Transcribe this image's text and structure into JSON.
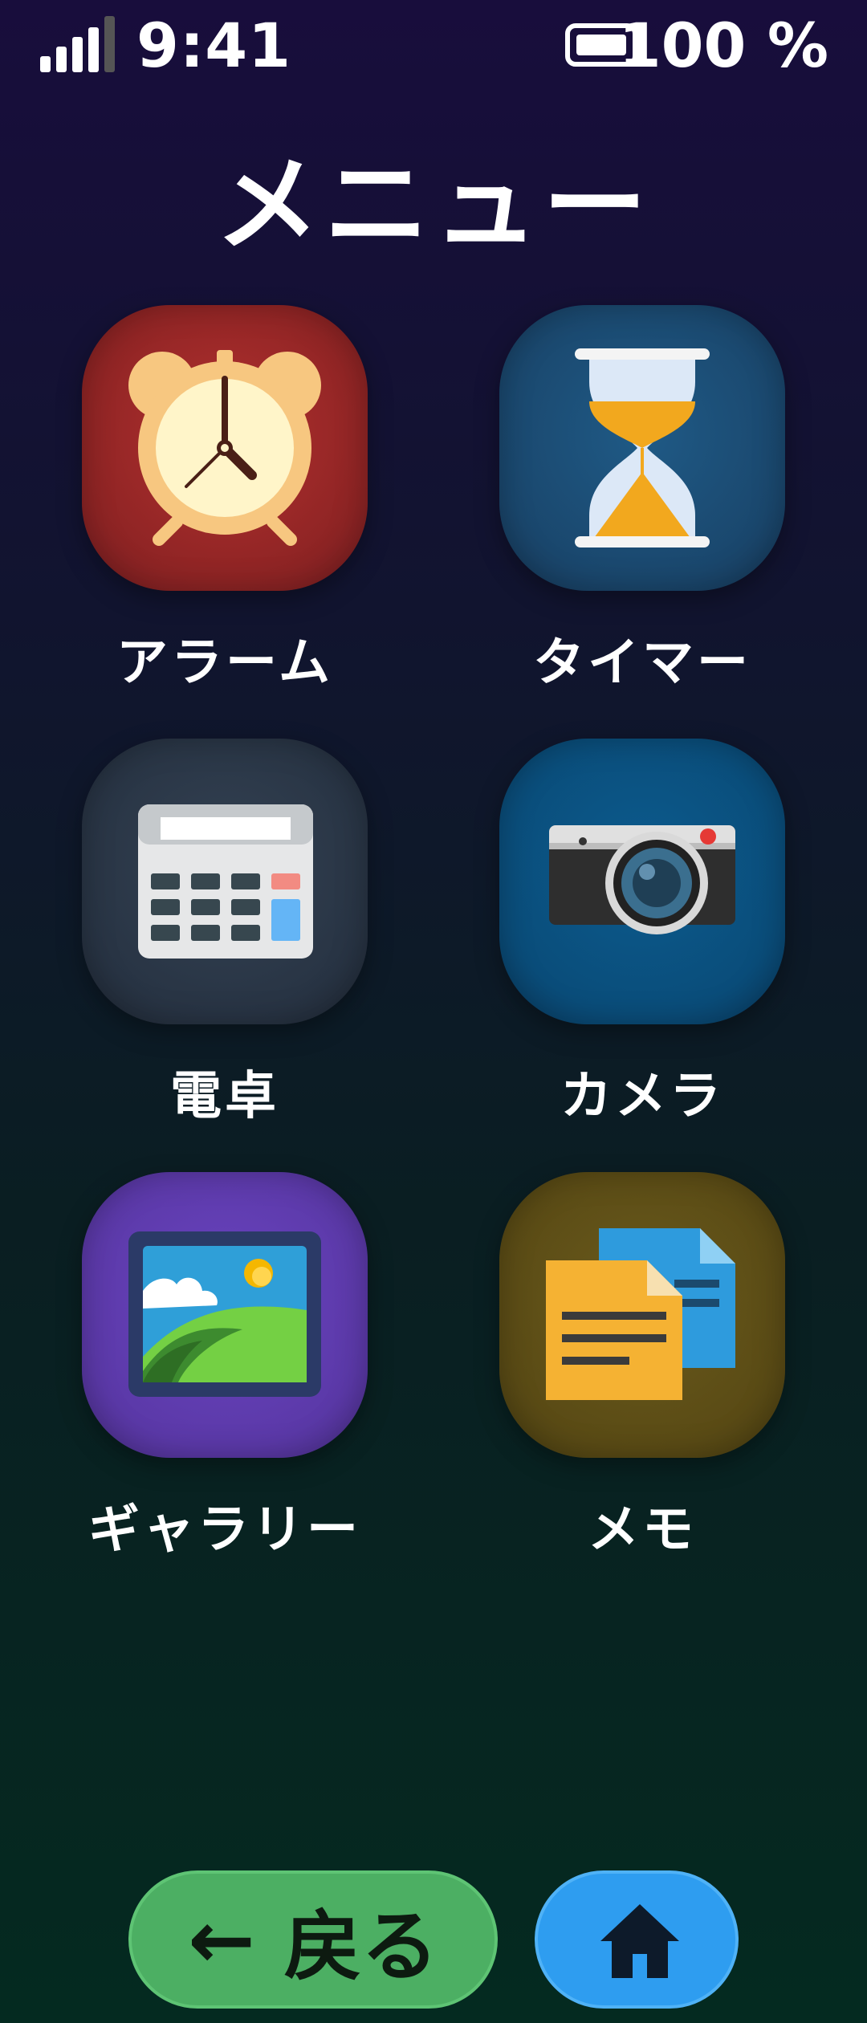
{
  "status": {
    "time": "9:41",
    "battery_percent": "100 %",
    "signal_icon": "signal-bars-icon",
    "battery_icon": "battery-full-icon"
  },
  "title": "メニュー",
  "tiles": [
    {
      "label": "アラーム",
      "icon": "alarm-clock-icon",
      "color": "#9b2a2a"
    },
    {
      "label": "タイマー",
      "icon": "hourglass-icon",
      "color": "#1b4a70"
    },
    {
      "label": "電卓",
      "icon": "calculator-icon",
      "color": "#2a3646"
    },
    {
      "label": "カメラ",
      "icon": "camera-icon",
      "color": "#0b5080"
    },
    {
      "label": "ギャラリー",
      "icon": "picture-icon",
      "color": "#5d3aac"
    },
    {
      "label": "メモ",
      "icon": "notes-icon",
      "color": "#5a4b16"
    }
  ],
  "nav": {
    "back_label": "戻る",
    "back_icon": "arrow-left-icon",
    "home_icon": "home-icon",
    "back_color": "#4caf63",
    "home_color": "#2e9df0"
  }
}
